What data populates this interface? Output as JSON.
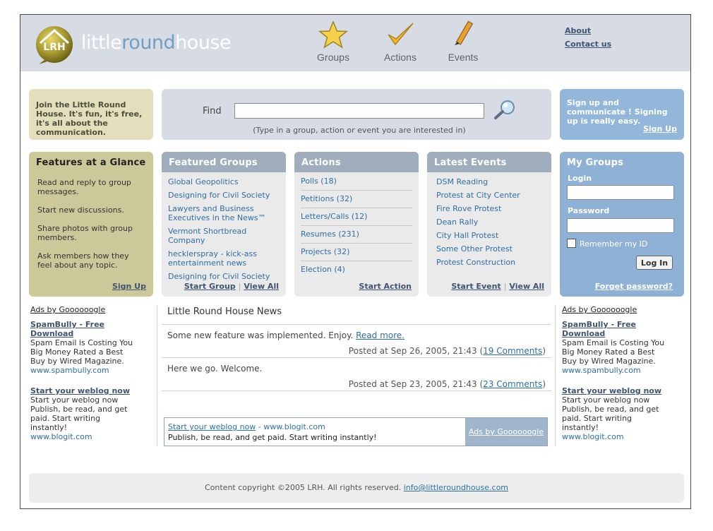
{
  "header": {
    "logo_word_1": "little",
    "logo_word_2": "round",
    "logo_word_3": "house",
    "logo_badge": "LRH",
    "nav": [
      {
        "label": "Groups",
        "icon": "star-icon"
      },
      {
        "label": "Actions",
        "icon": "checkmark-icon"
      },
      {
        "label": "Events",
        "icon": "pencil-icon"
      }
    ],
    "links": {
      "about": "About",
      "contact": "Contact us"
    }
  },
  "intro": {
    "text": "Join the Little Round House. It's fun, it's free, it's all about the communication."
  },
  "find": {
    "label": "Find",
    "value": "",
    "hint": "(Type in a group, action or event you are interested in)",
    "icon": "magnifier-icon"
  },
  "signup": {
    "text": "Sign up and communicate ! Signing up is really easy.",
    "link": "Sign Up"
  },
  "features": {
    "title": "Features at a Glance",
    "items": [
      "Read and reply to group messages.",
      "Start new discussions.",
      "Share photos with group members.",
      "Ask members how they feel about any topic."
    ],
    "link": "Sign Up"
  },
  "featured_groups": {
    "title": "Featured Groups",
    "items": [
      "Global Geopolitics",
      "Designing for Civil Society",
      "Lawyers and Business Executives in the News™",
      "Vermont Shortbread Company",
      "hecklerspray - kick-ass entertainment news",
      "Designing for Civil Society"
    ],
    "start": "Start Group",
    "view_all": "View All"
  },
  "actions": {
    "title": "Actions",
    "items": [
      "Polls (18)",
      "Petitions (32)",
      "Letters/Calls (12)",
      "Resumes (231)",
      "Projects (32)",
      "Election (4)"
    ],
    "start": "Start Action"
  },
  "events": {
    "title": "Latest Events",
    "items": [
      "DSM Reading",
      "Protest at City Center",
      "Fire Rove Protest",
      "Dean Rally",
      "City Hall Protest",
      "Some Other Protest",
      "Protest Construction"
    ],
    "start": "Start Event",
    "view_all": "View All"
  },
  "my_groups": {
    "title": "My Groups",
    "login_label": "Login",
    "login_value": "",
    "password_label": "Password",
    "password_value": "",
    "remember": "Remember my ID",
    "login_button": "Log In",
    "forgot": "Forget password?"
  },
  "ads": {
    "heading": "Ads by Goooooogle",
    "items": [
      {
        "title": "SpamBully - Free Download",
        "text": "Spam Email is Costing You Big Money Rated a Best Buy by Wired Magazine.",
        "url": "www.spambully.com"
      },
      {
        "title": "Start your weblog now",
        "text": "Start your weblog now Publish, be read, and get paid. Start writing instantly!",
        "url": "www.blogit.com"
      }
    ]
  },
  "news": {
    "title": "Little Round House News",
    "items": [
      {
        "text": "Some new feature was implemented. Enjoy.",
        "more": "Read more.",
        "posted": "Posted at Sep 26, 2005, 21:43 (",
        "comments": "19 Comments",
        "close": ")"
      },
      {
        "text": "Here we go. Welcome.",
        "posted": "Posted at Sep 23, 2005, 21:43 (",
        "comments": "23 Comments",
        "close": ")"
      }
    ]
  },
  "bottom_ad": {
    "link": "Start your weblog now",
    "url": " - www.blogit.com",
    "text": "Publish, be read, and get paid. Start writing instantly!",
    "adsby": "Ads by Goooooogle"
  },
  "footer": {
    "text": "Content copyright ©2005 LRH. All rights reserved. ",
    "email": "info@littleroundhouse.com"
  },
  "colors": {
    "header_bg": "#d7dbe4",
    "accent_blue": "#8fb1d6",
    "features_bg": "#cdc89a",
    "link": "#2d6fa7"
  }
}
